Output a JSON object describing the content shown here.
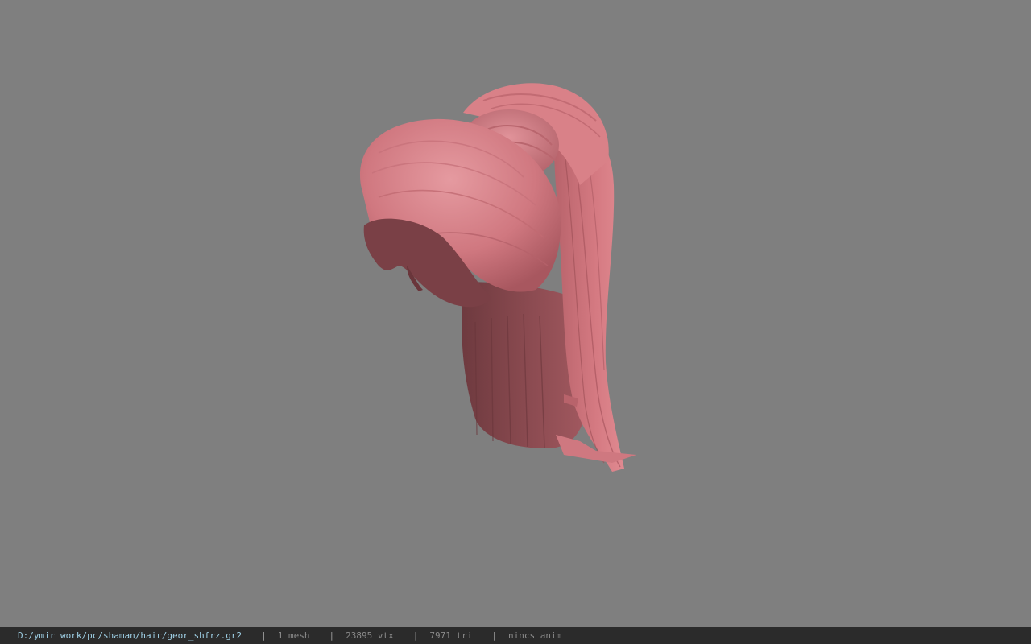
{
  "viewport": {
    "background": "#7f7f7f",
    "model_color": "#d57a82"
  },
  "statusbar": {
    "file_path": "D:/ymir work/pc/shaman/hair/geor_shfrz.gr2",
    "separator": "|",
    "mesh_count": "1 mesh",
    "vertex_count": "23895 vtx",
    "triangle_count": "7971 tri",
    "animation": "nincs anim"
  }
}
